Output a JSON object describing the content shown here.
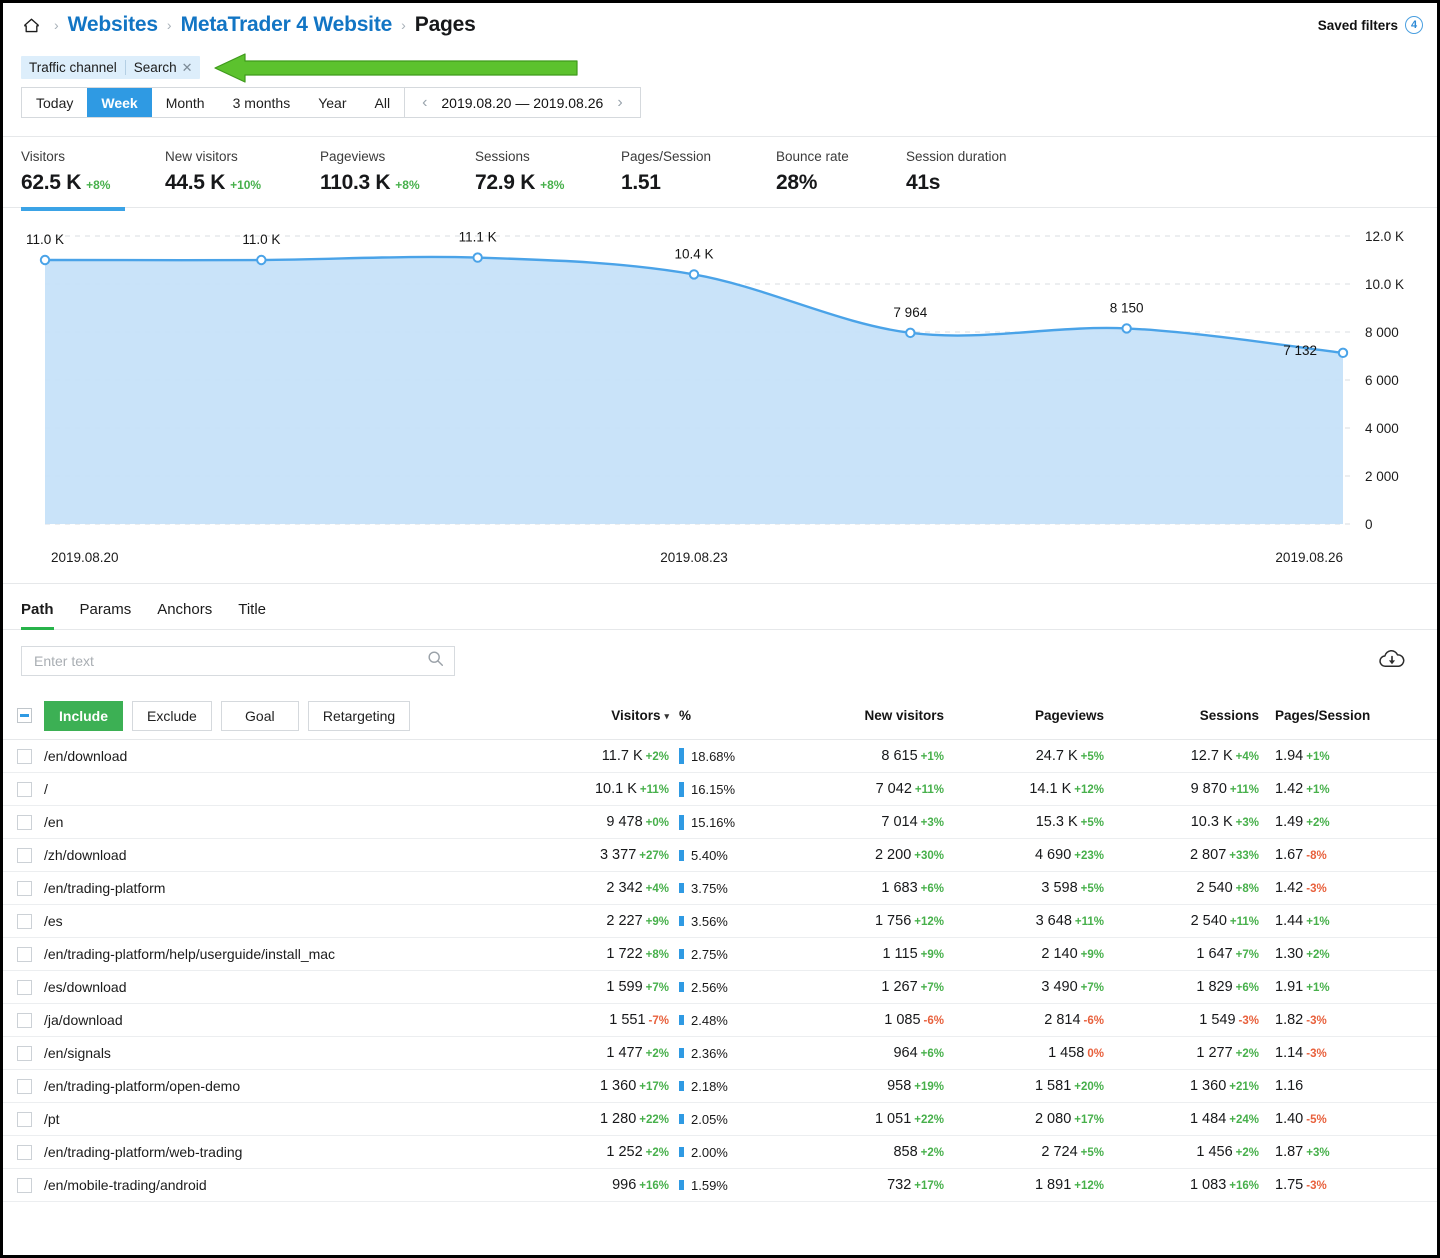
{
  "breadcrumb": {
    "home_icon": "home-icon",
    "separator": "›",
    "items": [
      {
        "label": "Websites",
        "current": false
      },
      {
        "label": "MetaTrader 4 Website",
        "current": false
      },
      {
        "label": "Pages",
        "current": true
      }
    ],
    "saved_filters_label": "Saved filters",
    "saved_filters_count": "4"
  },
  "filter_chip": {
    "category": "Traffic channel",
    "value": "Search",
    "remove_icon": "✕",
    "annotation_arrow_color": "#56c62b"
  },
  "period": {
    "buttons": [
      {
        "label": "Today",
        "active": false
      },
      {
        "label": "Week",
        "active": true
      },
      {
        "label": "Month",
        "active": false
      },
      {
        "label": "3 months",
        "active": false
      },
      {
        "label": "Year",
        "active": false
      },
      {
        "label": "All",
        "active": false
      }
    ],
    "prev_icon": "‹",
    "next_icon": "›",
    "range": "2019.08.20 — 2019.08.26",
    "active_color": "#2f9ae3"
  },
  "kpis": [
    {
      "label": "Visitors",
      "value": "62.5 K",
      "delta": "+8%",
      "dir": "up",
      "selected": true
    },
    {
      "label": "New visitors",
      "value": "44.5 K",
      "delta": "+10%",
      "dir": "up",
      "selected": false
    },
    {
      "label": "Pageviews",
      "value": "110.3 K",
      "delta": "+8%",
      "dir": "up",
      "selected": false
    },
    {
      "label": "Sessions",
      "value": "72.9 K",
      "delta": "+8%",
      "dir": "up",
      "selected": false
    },
    {
      "label": "Pages/Session",
      "value": "1.51",
      "delta": "",
      "dir": "",
      "selected": false
    },
    {
      "label": "Bounce rate",
      "value": "28%",
      "delta": "",
      "dir": "",
      "selected": false
    },
    {
      "label": "Session duration",
      "value": "41s",
      "delta": "",
      "dir": "",
      "selected": false
    }
  ],
  "chart_data": {
    "type": "area",
    "title": "",
    "xlabel": "",
    "ylabel": "",
    "series_name": "Visitors",
    "x": [
      "2019.08.20",
      "2019.08.21",
      "2019.08.22",
      "2019.08.23",
      "2019.08.24",
      "2019.08.25",
      "2019.08.26"
    ],
    "values": [
      11000,
      11000,
      11100,
      10400,
      7964,
      8150,
      7132
    ],
    "point_labels": [
      "11.0 K",
      "11.0 K",
      "11.1 K",
      "10.4 K",
      "7 964",
      "8 150",
      "7 132"
    ],
    "x_tick_labels": [
      "2019.08.20",
      "2019.08.23",
      "2019.08.26"
    ],
    "x_tick_indices": [
      0,
      3,
      6
    ],
    "y_ticks": [
      0,
      2000,
      4000,
      6000,
      8000,
      10000,
      12000
    ],
    "y_tick_labels": [
      "0",
      "2 000",
      "4 000",
      "6 000",
      "8 000",
      "10.0 K",
      "12.0 K"
    ],
    "ylim": [
      0,
      12000
    ],
    "grid": true,
    "legend": "none",
    "line_color": "#4aa3e8",
    "fill_color": "#c6e2f9"
  },
  "tabs": [
    {
      "label": "Path",
      "active": true
    },
    {
      "label": "Params",
      "active": false
    },
    {
      "label": "Anchors",
      "active": false
    },
    {
      "label": "Title",
      "active": false
    }
  ],
  "search": {
    "placeholder": "Enter text",
    "value": "",
    "icon": "search-icon",
    "export_icon": "cloud-download-icon"
  },
  "actions": {
    "select_all_state": "indeterminate",
    "buttons": [
      {
        "label": "Include",
        "primary": true
      },
      {
        "label": "Exclude",
        "primary": false
      },
      {
        "label": "Goal",
        "primary": false
      },
      {
        "label": "Retargeting",
        "primary": false
      }
    ]
  },
  "table": {
    "columns": [
      {
        "key": "visitors",
        "label": "Visitors",
        "sorted": true,
        "sort_caret": "▾"
      },
      {
        "key": "pct",
        "label": "%",
        "sorted": false,
        "sort_caret": ""
      },
      {
        "key": "new_visitors",
        "label": "New visitors",
        "sorted": false,
        "sort_caret": ""
      },
      {
        "key": "pageviews",
        "label": "Pageviews",
        "sorted": false,
        "sort_caret": ""
      },
      {
        "key": "sessions",
        "label": "Sessions",
        "sorted": false,
        "sort_caret": ""
      },
      {
        "key": "pages_session",
        "label": "Pages/Session",
        "sorted": false,
        "sort_caret": ""
      }
    ],
    "rows": [
      {
        "path": "/en/download",
        "visitors": "11.7 K",
        "visitors_d": "+2%",
        "visitors_dir": "up",
        "pct": "18.68%",
        "pct_num": 18.68,
        "new_visitors": "8 615",
        "new_visitors_d": "+1%",
        "new_visitors_dir": "up",
        "pageviews": "24.7 K",
        "pageviews_d": "+5%",
        "pageviews_dir": "up",
        "sessions": "12.7 K",
        "sessions_d": "+4%",
        "sessions_dir": "up",
        "pages_session": "1.94",
        "pages_session_d": "+1%",
        "pages_session_dir": "up"
      },
      {
        "path": "/",
        "visitors": "10.1 K",
        "visitors_d": "+11%",
        "visitors_dir": "up",
        "pct": "16.15%",
        "pct_num": 16.15,
        "new_visitors": "7 042",
        "new_visitors_d": "+11%",
        "new_visitors_dir": "up",
        "pageviews": "14.1 K",
        "pageviews_d": "+12%",
        "pageviews_dir": "up",
        "sessions": "9 870",
        "sessions_d": "+11%",
        "sessions_dir": "up",
        "pages_session": "1.42",
        "pages_session_d": "+1%",
        "pages_session_dir": "up"
      },
      {
        "path": "/en",
        "visitors": "9 478",
        "visitors_d": "+0%",
        "visitors_dir": "up",
        "pct": "15.16%",
        "pct_num": 15.16,
        "new_visitors": "7 014",
        "new_visitors_d": "+3%",
        "new_visitors_dir": "up",
        "pageviews": "15.3 K",
        "pageviews_d": "+5%",
        "pageviews_dir": "up",
        "sessions": "10.3 K",
        "sessions_d": "+3%",
        "sessions_dir": "up",
        "pages_session": "1.49",
        "pages_session_d": "+2%",
        "pages_session_dir": "up"
      },
      {
        "path": "/zh/download",
        "visitors": "3 377",
        "visitors_d": "+27%",
        "visitors_dir": "up",
        "pct": "5.40%",
        "pct_num": 5.4,
        "new_visitors": "2 200",
        "new_visitors_d": "+30%",
        "new_visitors_dir": "up",
        "pageviews": "4 690",
        "pageviews_d": "+23%",
        "pageviews_dir": "up",
        "sessions": "2 807",
        "sessions_d": "+33%",
        "sessions_dir": "up",
        "pages_session": "1.67",
        "pages_session_d": "-8%",
        "pages_session_dir": "down"
      },
      {
        "path": "/en/trading-platform",
        "visitors": "2 342",
        "visitors_d": "+4%",
        "visitors_dir": "up",
        "pct": "3.75%",
        "pct_num": 3.75,
        "new_visitors": "1 683",
        "new_visitors_d": "+6%",
        "new_visitors_dir": "up",
        "pageviews": "3 598",
        "pageviews_d": "+5%",
        "pageviews_dir": "up",
        "sessions": "2 540",
        "sessions_d": "+8%",
        "sessions_dir": "up",
        "pages_session": "1.42",
        "pages_session_d": "-3%",
        "pages_session_dir": "down"
      },
      {
        "path": "/es",
        "visitors": "2 227",
        "visitors_d": "+9%",
        "visitors_dir": "up",
        "pct": "3.56%",
        "pct_num": 3.56,
        "new_visitors": "1 756",
        "new_visitors_d": "+12%",
        "new_visitors_dir": "up",
        "pageviews": "3 648",
        "pageviews_d": "+11%",
        "pageviews_dir": "up",
        "sessions": "2 540",
        "sessions_d": "+11%",
        "sessions_dir": "up",
        "pages_session": "1.44",
        "pages_session_d": "+1%",
        "pages_session_dir": "up"
      },
      {
        "path": "/en/trading-platform/help/userguide/install_mac",
        "visitors": "1 722",
        "visitors_d": "+8%",
        "visitors_dir": "up",
        "pct": "2.75%",
        "pct_num": 2.75,
        "new_visitors": "1 115",
        "new_visitors_d": "+9%",
        "new_visitors_dir": "up",
        "pageviews": "2 140",
        "pageviews_d": "+9%",
        "pageviews_dir": "up",
        "sessions": "1 647",
        "sessions_d": "+7%",
        "sessions_dir": "up",
        "pages_session": "1.30",
        "pages_session_d": "+2%",
        "pages_session_dir": "up"
      },
      {
        "path": "/es/download",
        "visitors": "1 599",
        "visitors_d": "+7%",
        "visitors_dir": "up",
        "pct": "2.56%",
        "pct_num": 2.56,
        "new_visitors": "1 267",
        "new_visitors_d": "+7%",
        "new_visitors_dir": "up",
        "pageviews": "3 490",
        "pageviews_d": "+7%",
        "pageviews_dir": "up",
        "sessions": "1 829",
        "sessions_d": "+6%",
        "sessions_dir": "up",
        "pages_session": "1.91",
        "pages_session_d": "+1%",
        "pages_session_dir": "up"
      },
      {
        "path": "/ja/download",
        "visitors": "1 551",
        "visitors_d": "-7%",
        "visitors_dir": "down",
        "pct": "2.48%",
        "pct_num": 2.48,
        "new_visitors": "1 085",
        "new_visitors_d": "-6%",
        "new_visitors_dir": "down",
        "pageviews": "2 814",
        "pageviews_d": "-6%",
        "pageviews_dir": "down",
        "sessions": "1 549",
        "sessions_d": "-3%",
        "sessions_dir": "down",
        "pages_session": "1.82",
        "pages_session_d": "-3%",
        "pages_session_dir": "down"
      },
      {
        "path": "/en/signals",
        "visitors": "1 477",
        "visitors_d": "+2%",
        "visitors_dir": "up",
        "pct": "2.36%",
        "pct_num": 2.36,
        "new_visitors": "964",
        "new_visitors_d": "+6%",
        "new_visitors_dir": "up",
        "pageviews": "1 458",
        "pageviews_d": "0%",
        "pageviews_dir": "down",
        "sessions": "1 277",
        "sessions_d": "+2%",
        "sessions_dir": "up",
        "pages_session": "1.14",
        "pages_session_d": "-3%",
        "pages_session_dir": "down"
      },
      {
        "path": "/en/trading-platform/open-demo",
        "visitors": "1 360",
        "visitors_d": "+17%",
        "visitors_dir": "up",
        "pct": "2.18%",
        "pct_num": 2.18,
        "new_visitors": "958",
        "new_visitors_d": "+19%",
        "new_visitors_dir": "up",
        "pageviews": "1 581",
        "pageviews_d": "+20%",
        "pageviews_dir": "up",
        "sessions": "1 360",
        "sessions_d": "+21%",
        "sessions_dir": "up",
        "pages_session": "1.16",
        "pages_session_d": "",
        "pages_session_dir": ""
      },
      {
        "path": "/pt",
        "visitors": "1 280",
        "visitors_d": "+22%",
        "visitors_dir": "up",
        "pct": "2.05%",
        "pct_num": 2.05,
        "new_visitors": "1 051",
        "new_visitors_d": "+22%",
        "new_visitors_dir": "up",
        "pageviews": "2 080",
        "pageviews_d": "+17%",
        "pageviews_dir": "up",
        "sessions": "1 484",
        "sessions_d": "+24%",
        "sessions_dir": "up",
        "pages_session": "1.40",
        "pages_session_d": "-5%",
        "pages_session_dir": "down"
      },
      {
        "path": "/en/trading-platform/web-trading",
        "visitors": "1 252",
        "visitors_d": "+2%",
        "visitors_dir": "up",
        "pct": "2.00%",
        "pct_num": 2.0,
        "new_visitors": "858",
        "new_visitors_d": "+2%",
        "new_visitors_dir": "up",
        "pageviews": "2 724",
        "pageviews_d": "+5%",
        "pageviews_dir": "up",
        "sessions": "1 456",
        "sessions_d": "+2%",
        "sessions_dir": "up",
        "pages_session": "1.87",
        "pages_session_d": "+3%",
        "pages_session_dir": "up"
      },
      {
        "path": "/en/mobile-trading/android",
        "visitors": "996",
        "visitors_d": "+16%",
        "visitors_dir": "up",
        "pct": "1.59%",
        "pct_num": 1.59,
        "new_visitors": "732",
        "new_visitors_d": "+17%",
        "new_visitors_dir": "up",
        "pageviews": "1 891",
        "pageviews_d": "+12%",
        "pageviews_dir": "up",
        "sessions": "1 083",
        "sessions_d": "+16%",
        "sessions_dir": "up",
        "pages_session": "1.75",
        "pages_session_d": "-3%",
        "pages_session_dir": "down"
      }
    ]
  }
}
